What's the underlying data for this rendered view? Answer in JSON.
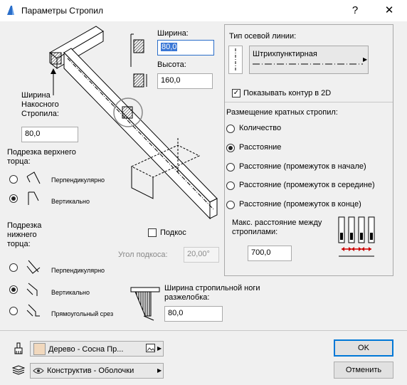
{
  "window": {
    "title": "Параметры Стропил",
    "help": "?",
    "close": "✕"
  },
  "left": {
    "ridge_width_label": "Ширина\nНакосного\nСтропила:",
    "ridge_width_value": "80,0",
    "width_label": "Ширина:",
    "width_value": "80,0",
    "height_label": "Высота:",
    "height_value": "160,0",
    "top_cut_label": "Подрезка верхнего\nторца:",
    "top_cut_options": [
      "Перпендикулярно",
      "Вертикально"
    ],
    "bottom_cut_label": "Подрезка\nнижнего\nторца:",
    "bottom_cut_options": [
      "Перпендикулярно",
      "Вертикально",
      "Прямоугольный срез"
    ],
    "strut_label": "Подкос",
    "strut_angle_label": "Угол подкоса:",
    "strut_angle_value": "20,00°",
    "groove_width_label": "Ширина стропильной ноги\nразжелобка:",
    "groove_width_value": "80,0"
  },
  "right": {
    "axis_type_label": "Тип осевой линии:",
    "axis_line_name": "Штрихпунктирная",
    "show_contour_label": "Показывать контур в 2D",
    "placement_label": "Размещение кратных стропил:",
    "placement_options": [
      "Количество",
      "Расстояние",
      "Расстояние (промежуток в начале)",
      "Расстояние (промежуток в середине)",
      "Расстояние (промежуток в конце)"
    ],
    "max_distance_label": "Макс. расстояние между\nстропилами:",
    "max_distance_value": "700,0"
  },
  "bottom": {
    "material": "Дерево - Сосна Пр...",
    "layer": "Конструктив - Оболочки",
    "ok": "OK",
    "cancel": "Отменить"
  },
  "colors": {
    "material_swatch": "#f1d8bd",
    "selection": "#3a77d6",
    "accent_red": "#cc0000"
  }
}
